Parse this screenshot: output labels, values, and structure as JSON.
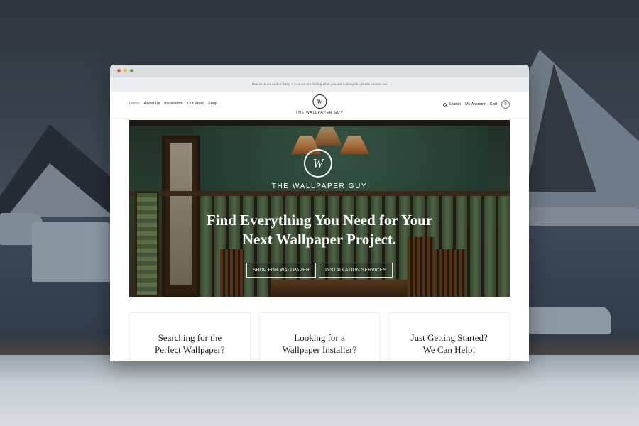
{
  "site": {
    "announcement": "New in Items added Daily. If you are not finding what you are looking for, please contact us!",
    "nav_left": [
      {
        "label": "Home",
        "active": true
      },
      {
        "label": "About Us",
        "active": false
      },
      {
        "label": "Installation",
        "active": false
      },
      {
        "label": "Our Work",
        "active": false
      },
      {
        "label": "Shop",
        "active": false
      }
    ],
    "brand": {
      "monogram": "W",
      "name": "THE WALLPAPER GUY"
    },
    "nav_right": {
      "search_label": "Search",
      "account_label": "My Account",
      "cart_label": "Cart",
      "cart_count": "0"
    }
  },
  "hero": {
    "logo_monogram": "W",
    "brand_name": "THE WALLPAPER GUY",
    "headline_line1": "Find Everything You Need for Your",
    "headline_line2": "Next Wallpaper Project.",
    "button_shop": "SHOP FOR WALLPAPER",
    "button_install": "INSTALLATION SERVICES"
  },
  "cards": [
    {
      "line1": "Searching for the",
      "line2": "Perfect Wallpaper?"
    },
    {
      "line1": "Looking for a",
      "line2": "Wallpaper Installer?"
    },
    {
      "line1": "Just Getting Started?",
      "line2": "We Can Help!"
    }
  ],
  "colors": {
    "window_chrome": "#dcdde1",
    "close_dot": "#e35a4f",
    "minimize_dot": "#e8b23b",
    "maximize_dot": "#4fb04a",
    "hero_green": "#2e5242"
  },
  "icons": {
    "search": "search-icon",
    "cart": "cart-icon"
  }
}
